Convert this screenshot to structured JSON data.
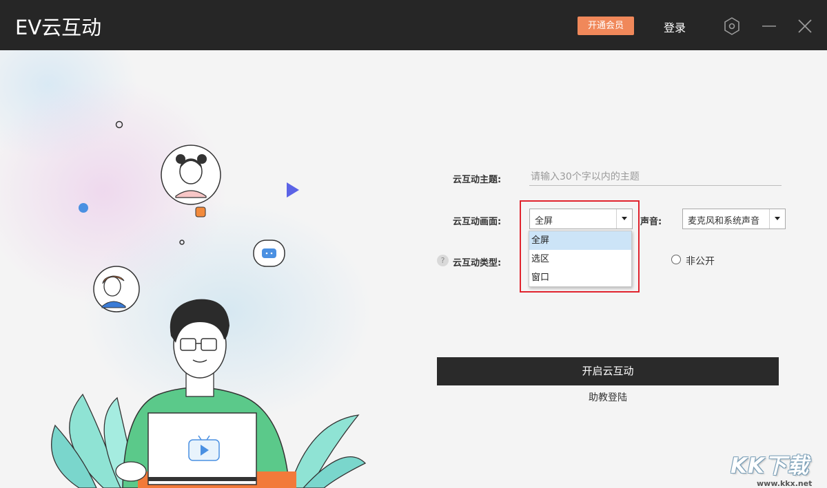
{
  "window": {
    "title": "EV云互动",
    "vip_label": "开通会员",
    "login_label": "登录"
  },
  "form": {
    "topic_label": "云互动主题:",
    "topic_placeholder": "请输入30个字以内的主题",
    "topic_value": "",
    "screen_label": "云互动画面:",
    "screen_selected": "全屏",
    "screen_options": [
      "全屏",
      "选区",
      "窗口"
    ],
    "sound_label": "声音:",
    "sound_selected": "麦克风和系统声音",
    "type_label": "云互动类型:",
    "type_option_private": "非公开",
    "help_symbol": "?"
  },
  "actions": {
    "start_label": "开启云互动",
    "assistant_label": "助教登陆"
  },
  "watermark": {
    "brand": "KK下载",
    "url": "www.kkx.net"
  },
  "colors": {
    "titlebar": "#262626",
    "vip_button": "#f0885a",
    "start_button": "#2a2a2a",
    "highlight_border": "#e0222c",
    "dropdown_selected": "#cce4f7"
  }
}
